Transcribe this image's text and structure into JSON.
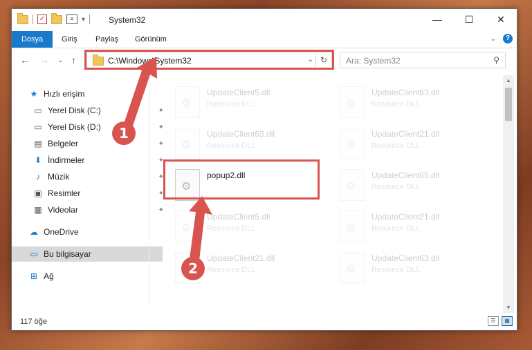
{
  "window": {
    "title": "System32",
    "controls": {
      "minimize": "—",
      "maximize": "☐",
      "close": "✕"
    }
  },
  "ribbon": {
    "tabs": [
      "Dosya",
      "Giriş",
      "Paylaş",
      "Görünüm"
    ],
    "expand": "⌄",
    "help": "?"
  },
  "nav": {
    "back": "←",
    "forward": "→",
    "recent": "⌄",
    "up": "↑",
    "address": "C:\\Windows\\System32",
    "dropdown": "⌄",
    "refresh": "↻",
    "search_placeholder": "Ara: System32",
    "search_icon": "⚲"
  },
  "sidebar": {
    "items": [
      {
        "label": "Hızlı erişim",
        "icon": "star-icon",
        "glyph": "★",
        "color": "#1979ca",
        "pinned": false
      },
      {
        "label": "Yerel Disk (C:)",
        "icon": "drive-icon",
        "glyph": "▭",
        "color": "#555555",
        "pinned": true
      },
      {
        "label": "Yerel Disk (D:)",
        "icon": "drive-icon",
        "glyph": "▭",
        "color": "#555555",
        "pinned": true
      },
      {
        "label": "Belgeler",
        "icon": "document-icon",
        "glyph": "▤",
        "color": "#555555",
        "pinned": true
      },
      {
        "label": "İndirmeler",
        "icon": "download-icon",
        "glyph": "⬇",
        "color": "#1979ca",
        "pinned": true
      },
      {
        "label": "Müzik",
        "icon": "music-icon",
        "glyph": "♪",
        "color": "#1979ca",
        "pinned": true
      },
      {
        "label": "Resimler",
        "icon": "pictures-icon",
        "glyph": "▣",
        "color": "#555555",
        "pinned": true
      },
      {
        "label": "Videolar",
        "icon": "video-icon",
        "glyph": "▦",
        "color": "#555555",
        "pinned": true
      },
      {
        "label": "OneDrive",
        "icon": "cloud-icon",
        "glyph": "☁",
        "color": "#1979ca",
        "pinned": false
      },
      {
        "label": "Bu bilgisayar",
        "icon": "computer-icon",
        "glyph": "▭",
        "color": "#1979ca",
        "pinned": false,
        "selected": true
      },
      {
        "label": "Ağ",
        "icon": "network-icon",
        "glyph": "⊞",
        "color": "#1979ca",
        "pinned": false
      }
    ],
    "pin_glyph": "📌"
  },
  "files": [
    {
      "name": "UpdateClient5.dll",
      "type": "Resource DLL",
      "faded": true
    },
    {
      "name": "UpdateClient63.dll",
      "type": "Resource DLL",
      "faded": true
    },
    {
      "name": "UpdateClient63.dll",
      "type": "Resource DLL",
      "faded": true
    },
    {
      "name": "UpdateClient21.dll",
      "type": "Resource DLL",
      "faded": true
    },
    {
      "name": "popup2.dll",
      "type": "",
      "faded": false
    },
    {
      "name": "UpdateClient65.dll",
      "type": "Resource DLL",
      "faded": true
    },
    {
      "name": "UpdateClient5.dll",
      "type": "Resource DLL",
      "faded": true
    },
    {
      "name": "UpdateClient21.dll",
      "type": "Resource DLL",
      "faded": true
    },
    {
      "name": "UpdateClient21.dll",
      "type": "Resource DLL",
      "faded": true
    },
    {
      "name": "UpdateClient63.dll",
      "type": "Resource DLL",
      "faded": true
    }
  ],
  "status": {
    "count": "117 öğe"
  },
  "annotations": {
    "marker1": "1",
    "marker2": "2",
    "color": "#d9534f"
  }
}
